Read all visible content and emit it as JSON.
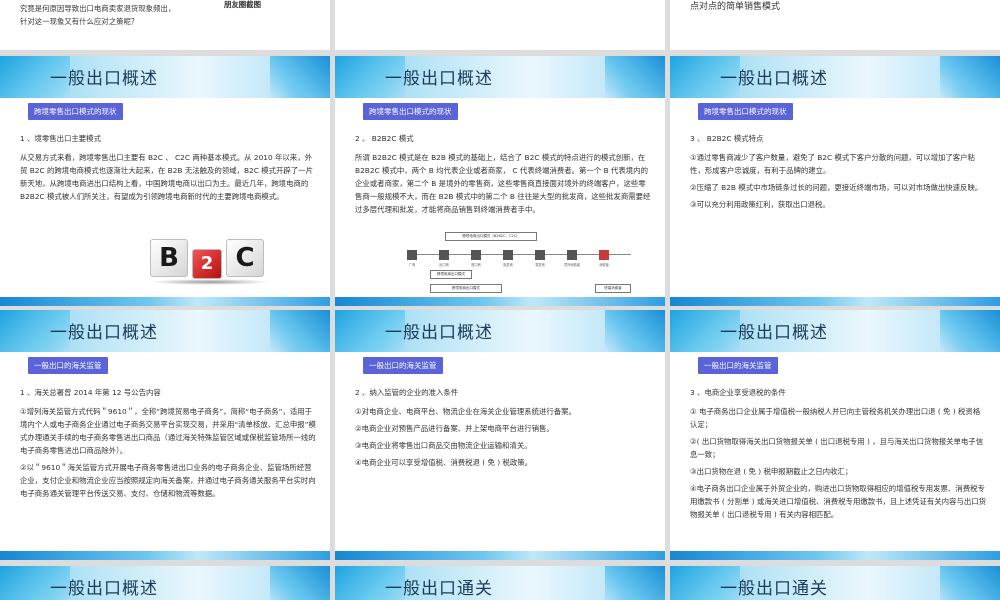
{
  "top": {
    "left_text": "究竟是何原因导致出口电商卖家退货现象频出，针对这一现象又有什么应对之策呢？",
    "center_caption": "朋友圈截图",
    "right_text": "点对点的简单销售模式"
  },
  "slides": [
    {
      "title": "一般出口概述",
      "badge": "跨境零售出口模式的现状",
      "heading": "1 、境零售出口主要模式",
      "paragraphs": [
        "从交易方式来看，跨境零售出口主要有 B2C 、 C2C 两种基本模式。从 2010 年以来，外贸 B2C 的跨境电商模式也逐渐壮大起来，在 B2B 无法触及的领域，B2C 模式开辟了一片新天地，从跨境电商进出口结构上看，中国跨境电商以出口为主。最近几年，跨境电商的 B2B2C 模式被人们所关注，有望成为引领跨境电商新时代的主要跨境电商模式。"
      ],
      "cube_letters": [
        "B",
        "2",
        "C"
      ]
    },
    {
      "title": "一般出口概述",
      "badge": "跨境零售出口模式的现状",
      "heading": "2 、 B2B2C 模式",
      "paragraphs": [
        "所谓 B2B2C 模式是在 B2B 模式的基础上，结合了 B2C 模式的特点进行的模式创新，在 B2B2C 模式中，两个 B 均代表企业或者商家， C 代表终端消费者。第一个 B 代表境内的企业或者商家，第二个 B 是境外的零售商，这些零售商直接面对境外的终端客户，这些零售商一般规模不大，而在 B2B 模式中的第二个 B 往往是大型的批发商，这些批发商需要经过多层代理和批发，才能将商品销售到终端消费者手中。"
      ],
      "flow": {
        "top_box": "跨境电商出口模式（B2B2C、C2C）",
        "mid_box": "跨境电商出口模式",
        "bottom_box": "跨境电商出口模式",
        "side_box": "终端消费者",
        "nodes": [
          "厂商",
          "出口商",
          "进口商",
          "批发商",
          "零售商",
          "境外消费者",
          "消费者"
        ]
      }
    },
    {
      "title": "一般出口概述",
      "badge": "跨境零售出口模式的现状",
      "heading": "3 、 B2B2C 模式特点",
      "paragraphs": [
        "①通过零售商减少了客户数量，避免了 B2C 模式下客户分散的问题，可以增加了客户粘性，形成客户忠诚度，有利于品牌的建立。",
        "②压缩了 B2B 模式中市场链条过长的问题，更接近终端市场，可以对市场做出快速反映。",
        "③可以充分利用政策红利，获取出口退税。"
      ]
    },
    {
      "title": "一般出口概述",
      "badge": "一般出口的海关监管",
      "heading": "1 、海关总署曾 2014 年第 12 号公告内容",
      "paragraphs": [
        "①增列海关监管方式代码＂9610＂，全称“跨境贸易电子商务”，简称“电子商务”，适用于境内个人或电子商务企业通过电子商务交易平台实现交易，并采用“清单核放、汇总申报”模式办理通关手续的电子商务零售进出口商品（通过海关特殊监管区域或保税监管场所一线的电子商务零售进出口商品除外）。",
        "②以＂9610＂海关监管方式开展电子商务零售进出口业务的电子商务企业、监管场所经营企业，支付企业和物流企业应当按照规定向海关备案，并通过电子商务通关服务平台实时向电子商务通关管理平台传送交易、支付、仓储和物流等数据。"
      ]
    },
    {
      "title": "一般出口概述",
      "badge": "一般出口的海关监管",
      "heading": "2 、纳入监管的企业的准入条件",
      "paragraphs": [
        "①对电商企业、电商平台、物流企业在海关企业管理系统进行备案。",
        "②电商企业对预售产品进行备案、并上架电商平台进行销售。",
        "③电商企业将零售出口商品交由物流企业运输和清关。",
        "④电商企业可以享受增值税、消费税退 ( 免 ) 税政策。"
      ]
    },
    {
      "title": "一般出口概述",
      "badge": "一般出口的海关监管",
      "heading": "3 、电商企业享受退税的条件",
      "paragraphs": [
        "①  电子商务出口企业属于增值税一般纳税人并已向主管税务机关办理出口退 ( 免 ) 税资格认定；",
        "②( 出口货物取得海关出口货物报关单 ( 出口退税专用 ) ，且与海关出口货物报关单电子信息一致；",
        "③出口货物在退 ( 免 ) 税申报期截止之日内收汇；",
        "④电子商务出口企业属于外贸企业的，购进出口货物取得相应的增值税专用发票、消费税专用缴款书 ( 分割单 ) 或海关进口增值税、消费税专用缴款书，且上述凭证有关内容与出口货物报关单 ( 出口退税专用 ) 有关内容相匹配。"
      ]
    },
    {
      "title": "一般出口概述"
    },
    {
      "title": "一般出口通关"
    },
    {
      "title": "一般出口通关"
    }
  ]
}
